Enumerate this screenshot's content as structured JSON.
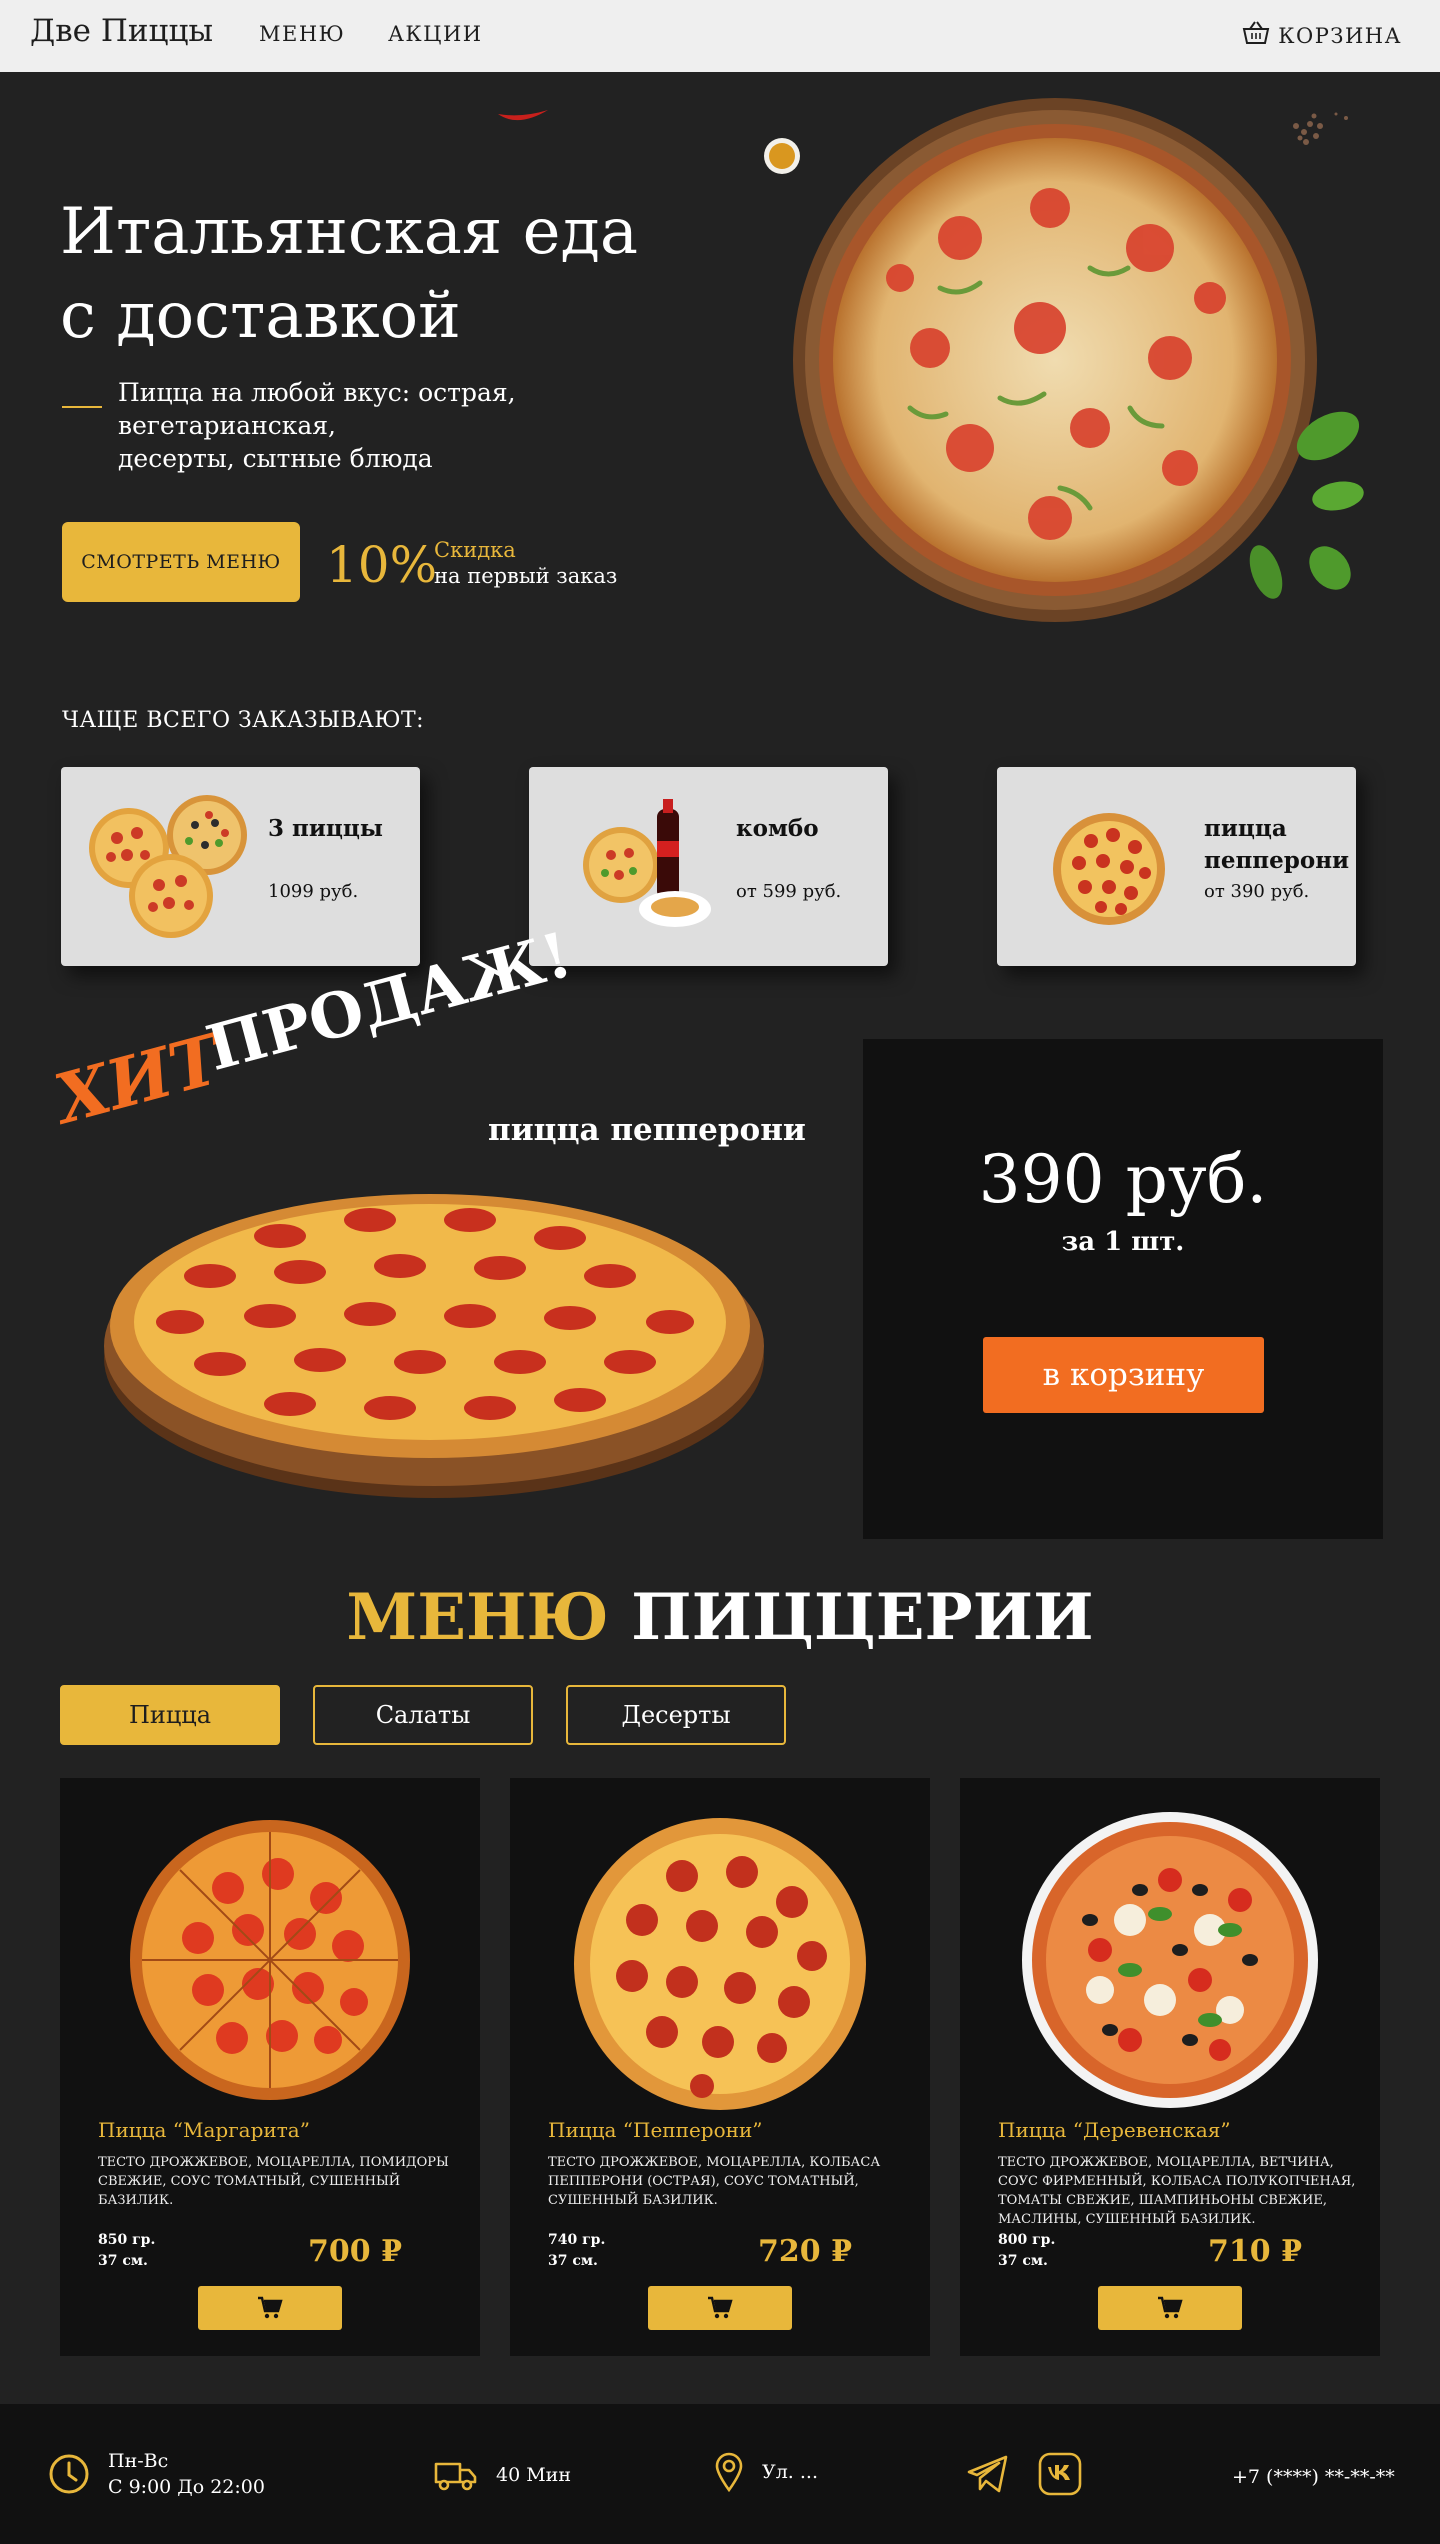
{
  "header": {
    "logo": "Две Пиццы",
    "nav": [
      "МЕНЮ",
      "АКЦИИ"
    ],
    "cart": "КОРЗИНА"
  },
  "hero": {
    "title_line1": "Итальянская еда",
    "title_line2": "с доставкой",
    "subtitle_line1": "Пицца на любой вкус: острая, вегетарианская,",
    "subtitle_line2": "десерты, сытные блюда",
    "cta": "СМОТРЕТЬ МЕНЮ",
    "promo_percent": "10%",
    "promo_label": "Скидка",
    "promo_text": "на первый заказ"
  },
  "popular": {
    "title": "ЧАЩЕ ВСЕГО ЗАКАЗЫВАЮТ:",
    "items": [
      {
        "name": "3 пиццы",
        "price": "1099 руб."
      },
      {
        "name": "комбо",
        "price": "от 599 руб."
      },
      {
        "name_line1": "пицца",
        "name_line2": "пепперони",
        "price": "от 390 руб."
      }
    ]
  },
  "bestseller": {
    "word1": "ХИТ",
    "word2": "ПРОДАЖ!",
    "name": "пицца пепперони",
    "price": "390 руб.",
    "unit": "за 1 шт.",
    "button": "в корзину"
  },
  "menu": {
    "title_accent": "МЕНЮ",
    "title_rest": "ПИЦЦЕРИИ",
    "tabs": [
      "Пицца",
      "Салаты",
      "Десерты"
    ],
    "items": [
      {
        "name": "Пицца “Маргарита”",
        "desc": "Тесто дрожжевое, моцарелла, помидоры свежие, соус томатный, сушенный базилик.",
        "weight": "850 гр.",
        "size": "37 см.",
        "price": "700 ₽"
      },
      {
        "name": "Пицца “Пепперони”",
        "desc": "Тесто дрожжевое, моцарелла, колбаса пепперони (острая), соус томатный, сушенный базилик.",
        "weight": "740 гр.",
        "size": "37 см.",
        "price": "720 ₽"
      },
      {
        "name": "Пицца “Деревенская”",
        "desc": "Тесто дрожжевое, моцарелла, ветчина, соус фирменный, колбаса полукопченая, томаты свежие, шампиньоны свежие, маслины, сушенный базилик.",
        "weight": "800 гр.",
        "size": "37 см.",
        "price": "710 ₽"
      }
    ]
  },
  "footer": {
    "hours_days": "Пн-Вс",
    "hours_time": "С 9:00 До 22:00",
    "delivery": "40 Мин",
    "address": "Ул. ...",
    "phone": "+7 (****) **-**-**"
  },
  "colors": {
    "accent": "#e8b73b",
    "orange": "#f26d21",
    "bg": "#222222",
    "card": "#111111"
  }
}
